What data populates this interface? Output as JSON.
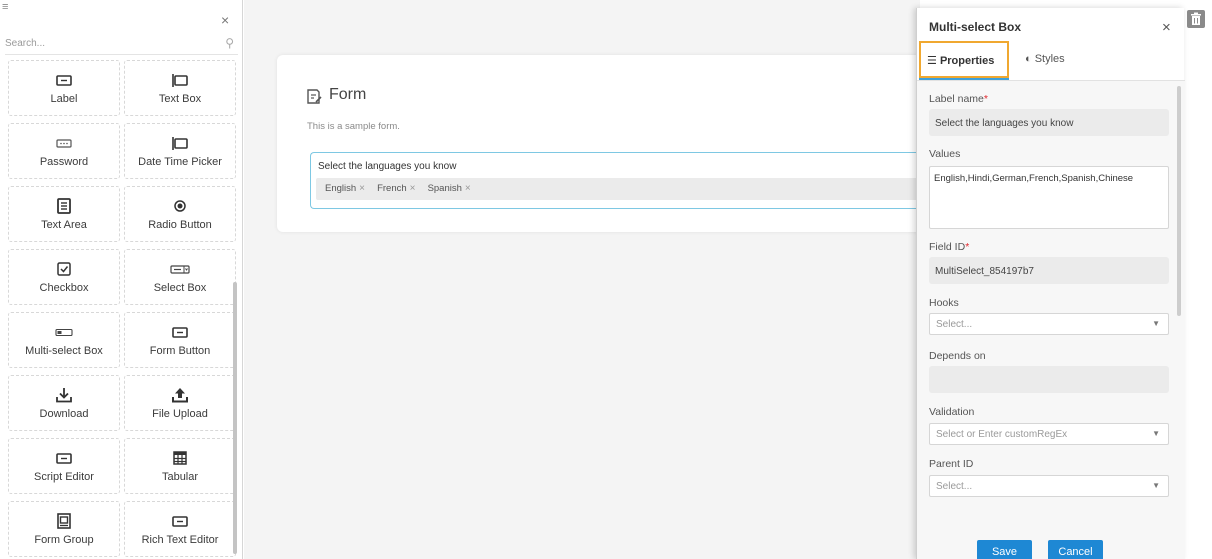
{
  "palette": {
    "search_placeholder": "Search...",
    "items": [
      {
        "label": "Label",
        "icon": "label-icon"
      },
      {
        "label": "Text Box",
        "icon": "text-box-icon"
      },
      {
        "label": "Password",
        "icon": "password-icon"
      },
      {
        "label": "Date Time Picker",
        "icon": "date-time-picker-icon"
      },
      {
        "label": "Text Area",
        "icon": "text-area-icon"
      },
      {
        "label": "Radio Button",
        "icon": "radio-button-icon"
      },
      {
        "label": "Checkbox",
        "icon": "checkbox-icon"
      },
      {
        "label": "Select Box",
        "icon": "select-box-icon"
      },
      {
        "label": "Multi-select Box",
        "icon": "multi-select-box-icon"
      },
      {
        "label": "Form Button",
        "icon": "form-button-icon"
      },
      {
        "label": "Download",
        "icon": "download-icon"
      },
      {
        "label": "File Upload",
        "icon": "file-upload-icon"
      },
      {
        "label": "Script Editor",
        "icon": "script-editor-icon"
      },
      {
        "label": "Tabular",
        "icon": "tabular-icon"
      },
      {
        "label": "Form Group",
        "icon": "form-group-icon"
      },
      {
        "label": "Rich Text Editor",
        "icon": "rich-text-editor-icon"
      }
    ]
  },
  "form": {
    "title": "Form",
    "description": "This is a sample form.",
    "field_label": "Select the languages you know",
    "tags": [
      "English",
      "French",
      "Spanish"
    ]
  },
  "panel": {
    "title": "Multi-select Box",
    "tabs": {
      "properties": "Properties",
      "styles": "Styles"
    },
    "label_name_label": "Label name",
    "label_name_value": "Select the languages you know",
    "values_label": "Values",
    "values_value": "English,Hindi,German,French,Spanish,Chinese",
    "field_id_label": "Field ID",
    "field_id_value": "MultiSelect_854197b7",
    "hooks_label": "Hooks",
    "hooks_placeholder": "Select...",
    "depends_on_label": "Depends on",
    "depends_on_value": "",
    "validation_label": "Validation",
    "validation_placeholder": "Select or Enter customRegEx",
    "parent_id_label": "Parent ID",
    "parent_id_placeholder": "Select...",
    "required_mark": "*",
    "save_label": "Save",
    "cancel_label": "Cancel"
  },
  "colors": {
    "accent": "#1e88d4",
    "tab_highlight": "#f0a830",
    "field_focus": "#7ec8e3",
    "required": "#e0282e"
  }
}
